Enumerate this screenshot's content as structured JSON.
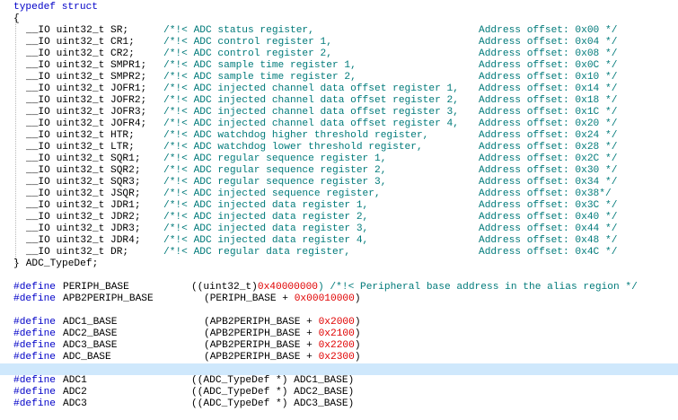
{
  "colors": {
    "keyword": "#0000c8",
    "comment": "#007a7a",
    "number": "#e00000",
    "text": "#000000",
    "current_line": "#cfe8fc",
    "background": "#ffffff"
  },
  "code": {
    "typedef_line": "typedef struct",
    "open_brace": "{",
    "close_brace": "}",
    "typedef_name": " ADC_TypeDef;",
    "members": [
      {
        "decl": "__IO uint32_t SR;",
        "desc": "/*!< ADC status register,",
        "offset": "Address offset: 0x00 */"
      },
      {
        "decl": "__IO uint32_t CR1;",
        "desc": "/*!< ADC control register 1,",
        "offset": "Address offset: 0x04 */"
      },
      {
        "decl": "__IO uint32_t CR2;",
        "desc": "/*!< ADC control register 2,",
        "offset": "Address offset: 0x08 */"
      },
      {
        "decl": "__IO uint32_t SMPR1;",
        "desc": "/*!< ADC sample time register 1,",
        "offset": "Address offset: 0x0C */"
      },
      {
        "decl": "__IO uint32_t SMPR2;",
        "desc": "/*!< ADC sample time register 2,",
        "offset": "Address offset: 0x10 */"
      },
      {
        "decl": "__IO uint32_t JOFR1;",
        "desc": "/*!< ADC injected channel data offset register 1,",
        "offset": "Address offset: 0x14 */"
      },
      {
        "decl": "__IO uint32_t JOFR2;",
        "desc": "/*!< ADC injected channel data offset register 2,",
        "offset": "Address offset: 0x18 */"
      },
      {
        "decl": "__IO uint32_t JOFR3;",
        "desc": "/*!< ADC injected channel data offset register 3,",
        "offset": "Address offset: 0x1C */"
      },
      {
        "decl": "__IO uint32_t JOFR4;",
        "desc": "/*!< ADC injected channel data offset register 4,",
        "offset": "Address offset: 0x20 */"
      },
      {
        "decl": "__IO uint32_t HTR;",
        "desc": "/*!< ADC watchdog higher threshold register,",
        "offset": "Address offset: 0x24 */"
      },
      {
        "decl": "__IO uint32_t LTR;",
        "desc": "/*!< ADC watchdog lower threshold register,",
        "offset": "Address offset: 0x28 */"
      },
      {
        "decl": "__IO uint32_t SQR1;",
        "desc": "/*!< ADC regular sequence register 1,",
        "offset": "Address offset: 0x2C */"
      },
      {
        "decl": "__IO uint32_t SQR2;",
        "desc": "/*!< ADC regular sequence register 2,",
        "offset": "Address offset: 0x30 */"
      },
      {
        "decl": "__IO uint32_t SQR3;",
        "desc": "/*!< ADC regular sequence register 3,",
        "offset": "Address offset: 0x34 */"
      },
      {
        "decl": "__IO uint32_t JSQR;",
        "desc": "/*!< ADC injected sequence register,",
        "offset": "Address offset: 0x38*/"
      },
      {
        "decl": "__IO uint32_t JDR1;",
        "desc": "/*!< ADC injected data register 1,",
        "offset": "Address offset: 0x3C */"
      },
      {
        "decl": "__IO uint32_t JDR2;",
        "desc": "/*!< ADC injected data register 2,",
        "offset": "Address offset: 0x40 */"
      },
      {
        "decl": "__IO uint32_t JDR3;",
        "desc": "/*!< ADC injected data register 3,",
        "offset": "Address offset: 0x44 */"
      },
      {
        "decl": "__IO uint32_t JDR4;",
        "desc": "/*!< ADC injected data register 4,",
        "offset": "Address offset: 0x48 */"
      },
      {
        "decl": "__IO uint32_t DR;",
        "desc": "/*!< ADC regular data register,",
        "offset": "Address offset: 0x4C */"
      }
    ],
    "defines": [
      {
        "directive": "#define",
        "name": "PERIPH_BASE",
        "pre": "((uint32_t)",
        "num": "0x40000000",
        "post": ") /*!< Peripheral base address in the alias region */"
      },
      {
        "directive": "#define",
        "name": "APB2PERIPH_BASE",
        "pre": "(PERIPH_BASE + ",
        "num": "0x00010000",
        "post": ")"
      },
      {
        "directive": "#define",
        "name": "ADC1_BASE",
        "pre": "(APB2PERIPH_BASE + ",
        "num": "0x2000",
        "post": ")"
      },
      {
        "directive": "#define",
        "name": "ADC2_BASE",
        "pre": "(APB2PERIPH_BASE + ",
        "num": "0x2100",
        "post": ")"
      },
      {
        "directive": "#define",
        "name": "ADC3_BASE",
        "pre": "(APB2PERIPH_BASE + ",
        "num": "0x2200",
        "post": ")"
      },
      {
        "directive": "#define",
        "name": "ADC_BASE",
        "pre": "(APB2PERIPH_BASE + ",
        "num": "0x2300",
        "post": ")"
      },
      {
        "directive": "#define",
        "name": "ADC1",
        "pre": "((ADC_TypeDef *) ADC1_BASE)",
        "num": "",
        "post": ""
      },
      {
        "directive": "#define",
        "name": "ADC2",
        "pre": "((ADC_TypeDef *) ADC2_BASE)",
        "num": "",
        "post": ""
      },
      {
        "directive": "#define",
        "name": "ADC3",
        "pre": "((ADC_TypeDef *) ADC3_BASE)",
        "num": "",
        "post": ""
      }
    ]
  }
}
